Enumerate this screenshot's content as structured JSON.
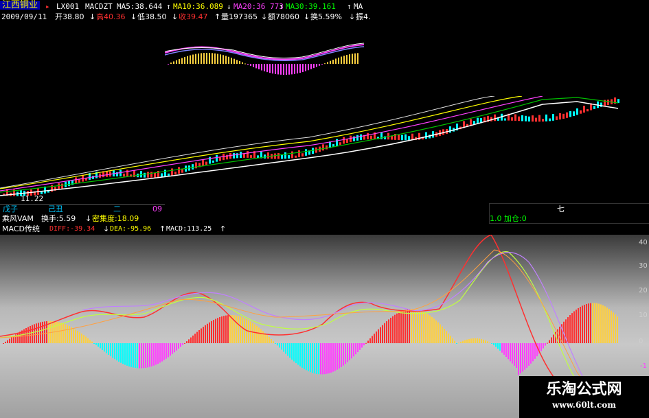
{
  "header": {
    "stock_name": "江西铜业",
    "code": "LX001",
    "indicator": "MACDZT",
    "ma5": "MA5:38.644",
    "ma10": "MA10:36.089",
    "ma20": "MA20:36 773",
    "ma30": "MA30:39.161",
    "ma_more": "MA",
    "date": "2009/09/11",
    "open": "开38.80",
    "high": "高40.36",
    "low": "低38.50",
    "close": "收39.47",
    "volume": "量197365",
    "amount": "额78060",
    "turnover": "换5.59%",
    "amplitude": "振4.",
    "arrow_up": "↑",
    "arrow_down": "↓"
  },
  "main_chart": {
    "low_label": "11.22"
  },
  "periods": [
    "戊子",
    "己丑",
    "二",
    "09"
  ],
  "info": {
    "vam": "乘风VAM",
    "turnover_label": "换手:5.59",
    "density": "密集度:18.09",
    "macd_name": "MACD传统",
    "diff": "DIFF:-39.34",
    "dea": "DEA:-95.96",
    "macd": "MACD:113.25"
  },
  "right_box": {
    "seven": "七",
    "position": "1.0 加仓:0"
  },
  "macd_axis": [
    "40",
    "30",
    "20",
    "10",
    "0",
    "-1"
  ],
  "watermark": {
    "title": "乐淘公式网",
    "url": "www.60lt.com"
  },
  "colors": {
    "up": "#ff3030",
    "down": "#00ffff",
    "yellow": "#ffd040",
    "magenta": "#ff40ff"
  }
}
